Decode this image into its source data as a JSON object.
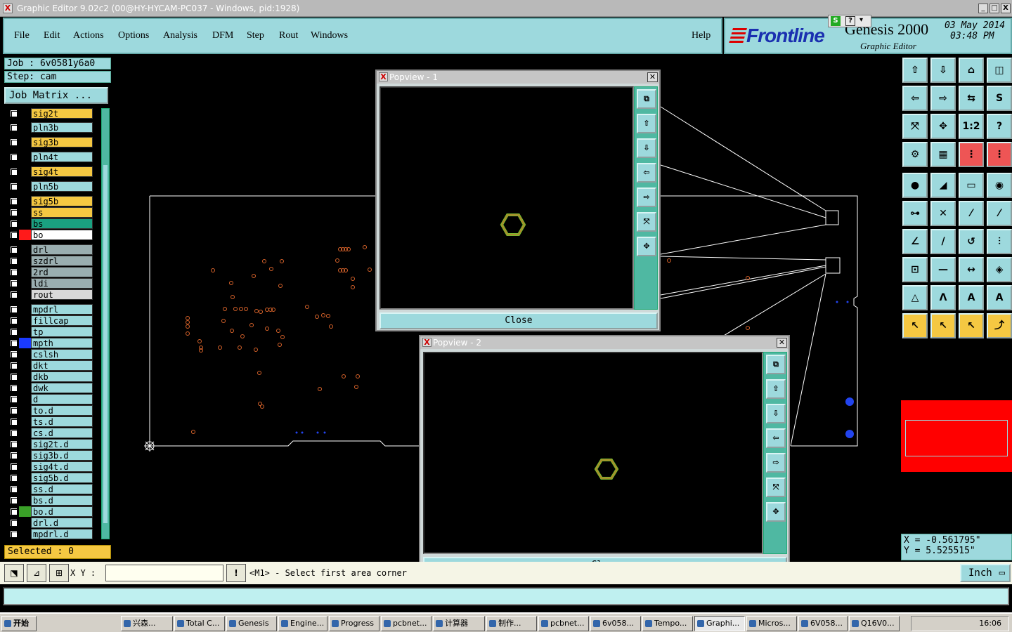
{
  "window": {
    "title": "Graphic Editor 9.02c2 (00@HY-HYCAM-PC037 - Windows, pid:1928)",
    "min": "_",
    "max": "□",
    "close": "X"
  },
  "menu": {
    "items": [
      "File",
      "Edit",
      "Actions",
      "Options",
      "Analysis",
      "DFM",
      "Step",
      "Rout",
      "Windows"
    ],
    "help": "Help"
  },
  "brand": {
    "logo": "Frontline",
    "product": "Genesis 2000",
    "subtitle": "Graphic Editor",
    "date": "03 May 2014",
    "time": "03:48 PM"
  },
  "job": {
    "job_line": "Job : 6v0581y6a0",
    "step_line": "Step: cam",
    "matrix_button": "Job Matrix ...",
    "selected": "Selected : 0"
  },
  "layers": [
    {
      "name": "sig2t",
      "color": "#f5c842"
    },
    {
      "name": "pln3b",
      "color": "#9dd9dd"
    },
    {
      "name": "sig3b",
      "color": "#f5c842"
    },
    {
      "name": "pln4t",
      "color": "#9dd9dd"
    },
    {
      "name": "sig4t",
      "color": "#f5c842"
    },
    {
      "name": "pln5b",
      "color": "#9dd9dd"
    },
    {
      "name": "sig5b",
      "color": "#f5c842"
    },
    {
      "name": "ss",
      "color": "#f5c842"
    },
    {
      "name": "bs",
      "color": "#1aa080"
    },
    {
      "name": "bo",
      "color": "#ffffff"
    },
    {
      "name": "drl",
      "color": "#9aaeb0"
    },
    {
      "name": "szdrl",
      "color": "#9aaeb0"
    },
    {
      "name": "2rd",
      "color": "#9aaeb0"
    },
    {
      "name": "ldi",
      "color": "#9aaeb0"
    },
    {
      "name": "rout",
      "color": "#d8d8d8"
    },
    {
      "name": "mpdrl",
      "color": "#9dd9dd"
    },
    {
      "name": "fillcap",
      "color": "#9dd9dd"
    },
    {
      "name": "tp",
      "color": "#9dd9dd"
    },
    {
      "name": "mpth",
      "color": "#9dd9dd"
    },
    {
      "name": "cslsh",
      "color": "#9dd9dd"
    },
    {
      "name": "dkt",
      "color": "#9dd9dd"
    },
    {
      "name": "dkb",
      "color": "#9dd9dd"
    },
    {
      "name": "dwk",
      "color": "#9dd9dd"
    },
    {
      "name": "d",
      "color": "#9dd9dd"
    },
    {
      "name": "to.d",
      "color": "#9dd9dd"
    },
    {
      "name": "ts.d",
      "color": "#9dd9dd"
    },
    {
      "name": "cs.d",
      "color": "#9dd9dd"
    },
    {
      "name": "sig2t.d",
      "color": "#9dd9dd"
    },
    {
      "name": "sig3b.d",
      "color": "#9dd9dd"
    },
    {
      "name": "sig4t.d",
      "color": "#9dd9dd"
    },
    {
      "name": "sig5b.d",
      "color": "#9dd9dd"
    },
    {
      "name": "ss.d",
      "color": "#9dd9dd"
    },
    {
      "name": "bs.d",
      "color": "#9dd9dd"
    },
    {
      "name": "bo.d",
      "color": "#9dd9dd"
    },
    {
      "name": "drl.d",
      "color": "#9dd9dd"
    },
    {
      "name": "mpdrl.d",
      "color": "#9dd9dd"
    }
  ],
  "popview1": {
    "title": "Popview - 1",
    "close": "Close"
  },
  "popview2": {
    "title": "Popview - 2",
    "close": "Close"
  },
  "coords": {
    "x": "X = -0.561795\"",
    "y": "Y = 5.525515\""
  },
  "command": {
    "xy_label": "X Y :",
    "xy_value": "",
    "warn": "!",
    "message": "<M1> - Select first area corner",
    "units": "Inch"
  },
  "taskbar": {
    "start": "开始",
    "tasks": [
      "兴森...",
      "Total C...",
      "Genesis",
      "Engine...",
      "Progress",
      "pcbnet...",
      "计算器",
      "制作...",
      "pcbnet...",
      "6v058...",
      "Tempo...",
      "Graphi...",
      "Micros...",
      "6V058...",
      "Q16V0..."
    ],
    "active_task": "Graphi...",
    "clock": "16:06"
  },
  "colors": {
    "panel": "#9dd9dd",
    "highlight": "#f5c842",
    "canvas": "#000000",
    "outline": "#ffffff",
    "drill": "#d8632a",
    "hexagon": "#7ab82e"
  }
}
